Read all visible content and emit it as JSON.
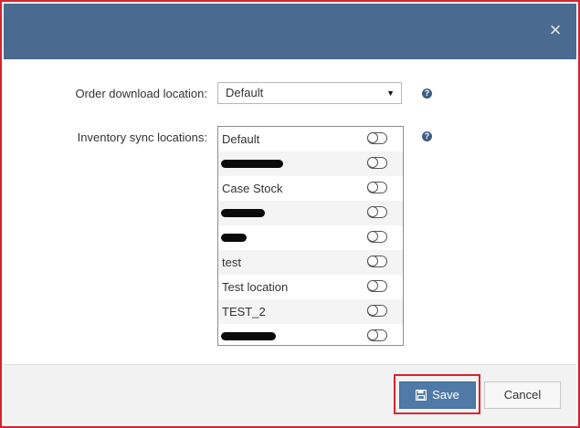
{
  "dialog": {
    "close_label": "×",
    "header_color": "#4a6a8f"
  },
  "order_download": {
    "label": "Order download location:",
    "selected": "Default",
    "help": "?"
  },
  "inventory_sync": {
    "label": "Inventory sync locations:",
    "help": "?",
    "items": [
      {
        "label": "Default",
        "enabled": false
      },
      {
        "label": "",
        "redacted": true,
        "enabled": false
      },
      {
        "label": "Case Stock",
        "enabled": false
      },
      {
        "label": "",
        "redacted": true,
        "enabled": false
      },
      {
        "label": "",
        "redacted": true,
        "enabled": false
      },
      {
        "label": "test",
        "enabled": false
      },
      {
        "label": "Test location",
        "enabled": false
      },
      {
        "label": "TEST_2",
        "enabled": false
      },
      {
        "label": "",
        "redacted": true,
        "enabled": false
      }
    ]
  },
  "footer": {
    "save_label": "Save",
    "cancel_label": "Cancel",
    "highlight_color": "#d9232d"
  }
}
